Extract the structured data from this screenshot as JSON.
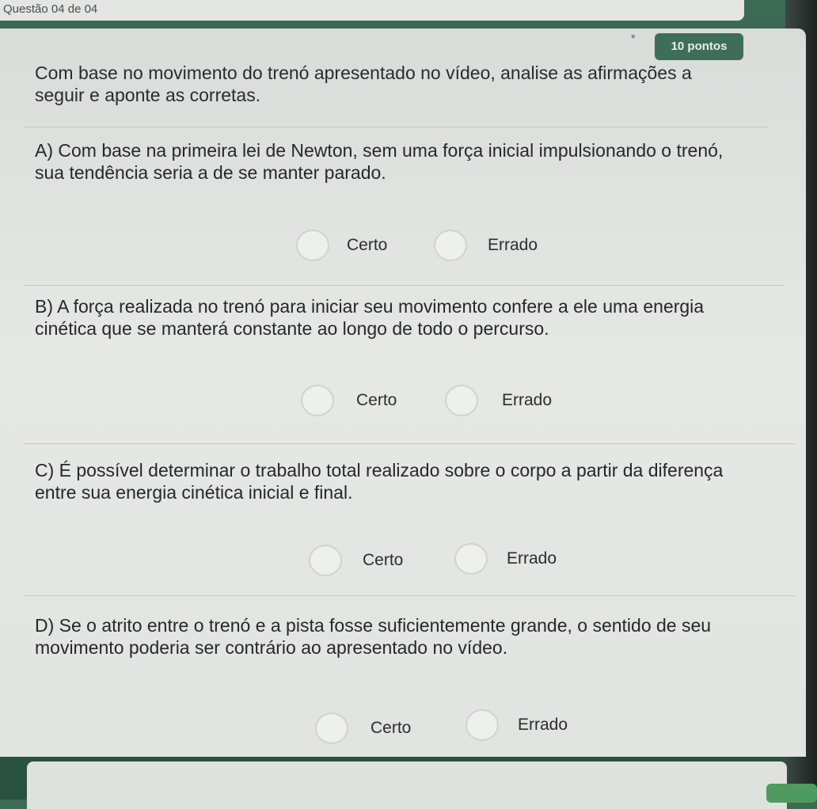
{
  "header": {
    "question_counter": "Questão 04 de 04"
  },
  "question": {
    "required_marker": "*",
    "points": "10 pontos",
    "prompt": "Com base no movimento do trenó apresentado no vídeo, analise as afirmações a seguir e aponte as corretas."
  },
  "items": [
    {
      "statement": "A) Com base na primeira lei de Newton, sem uma força inicial impulsionando o trenó, sua tendência seria a de se manter parado.",
      "option_true": "Certo",
      "option_false": "Errado"
    },
    {
      "statement": "B) A força realizada no trenó para iniciar seu movimento confere a ele uma energia cinética que se manterá constante ao longo de todo o percurso.",
      "option_true": "Certo",
      "option_false": "Errado"
    },
    {
      "statement": "C) É possível determinar o trabalho total realizado sobre o corpo a partir da diferença entre sua energia cinética inicial e final.",
      "option_true": "Certo",
      "option_false": "Errado"
    },
    {
      "statement": "D) Se o atrito entre o trenó e a pista fosse suficientemente grande, o sentido de seu movimento poderia ser contrário ao apresentado no vídeo.",
      "option_true": "Certo",
      "option_false": "Errado"
    }
  ]
}
